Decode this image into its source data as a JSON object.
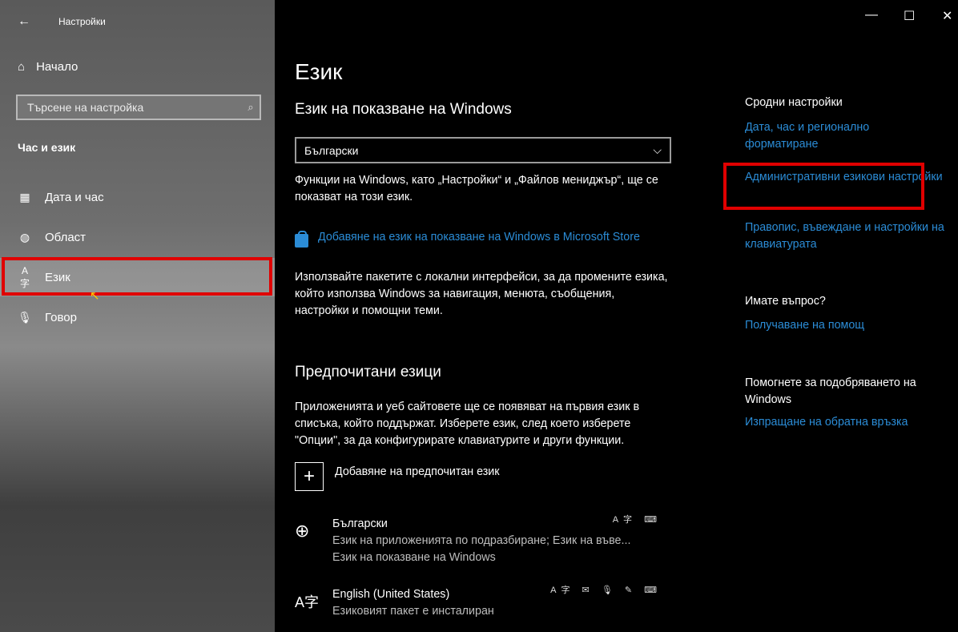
{
  "window": {
    "title": "Настройки",
    "back_glyph": "←",
    "controls": {
      "minimize": "—",
      "maximize": "☐",
      "close": "✕"
    }
  },
  "sidebar": {
    "home_label": "Начало",
    "search_placeholder": "Търсене на настройка",
    "section_title": "Час и език",
    "items": [
      {
        "label": "Дата и час",
        "icon": "calendar-clock-icon"
      },
      {
        "label": "Област",
        "icon": "globe-region-icon"
      },
      {
        "label": "Език",
        "icon": "language-icon",
        "selected": true
      },
      {
        "label": "Говор",
        "icon": "microphone-icon"
      }
    ]
  },
  "main": {
    "page_title": "Език",
    "display_heading": "Език на показване на Windows",
    "display_language_value": "Български",
    "display_desc": "Функции на Windows, като „Настройки“ и „Файлов мениджър“, ще се показват на този език.",
    "store_link": "Добавяне на език на показване на Windows в Microsoft Store",
    "store_desc": "Използвайте пакетите с локални интерфейси, за да промените езика, който използва Windows за навигация, менюта, съобщения, настройки и помощни теми.",
    "preferred_heading": "Предпочитани езици",
    "preferred_desc": "Приложенията и уеб сайтовете ще се появяват на първия език в списъка, който поддържат. Изберете език, след което изберете \"Опции\", за да конфигурирате клавиатурите и други функции.",
    "add_preferred_label": "Добавяне на предпочитан език",
    "languages": [
      {
        "name": "Български",
        "sub1": "Език на приложенията по подразбиране; Език на въве...",
        "sub2": "Език на показване на Windows",
        "capability_icons": "A字 ⌨"
      },
      {
        "name": "English (United States)",
        "sub1": "Езиковият пакет е инсталиран",
        "sub2": "",
        "capability_icons": "A字 ✉ 🎙 ✎ ⌨"
      }
    ]
  },
  "related": {
    "heading": "Сродни настройки",
    "links": [
      "Дата, час и регионално форматиране",
      "Административни езикови настройки",
      "Правопис, въвеждане и настройки на клавиатурата"
    ],
    "question_heading": "Имате въпрос?",
    "help_link": "Получаване на помощ",
    "improve_heading": "Помогнете за подобряването на Windows",
    "feedback_link": "Изпращане на обратна връзка"
  },
  "colors": {
    "link": "#2b8cd6",
    "highlight_box": "#e00000",
    "background": "#000000"
  }
}
